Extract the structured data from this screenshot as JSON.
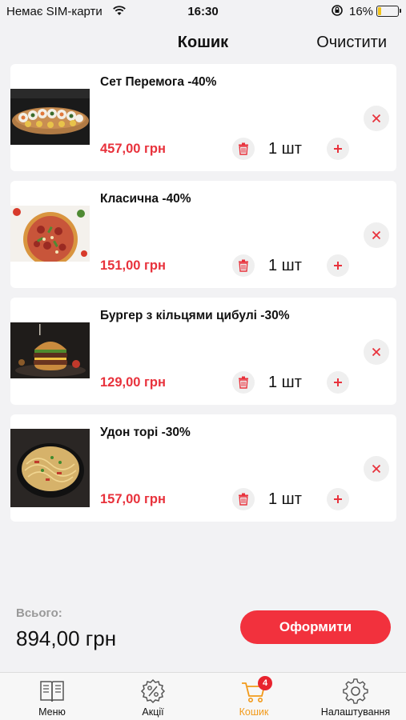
{
  "status_bar": {
    "carrier": "Немає SIM-карти",
    "time": "16:30",
    "battery": "16%",
    "battery_level": 0.16
  },
  "header": {
    "title": "Кошик",
    "clear_label": "Очистити"
  },
  "cart": {
    "items": [
      {
        "name": "Сет Перемога -40%",
        "price": "457,00 грн",
        "qty": "1 шт",
        "image": "sushi-set"
      },
      {
        "name": "Класична -40%",
        "price": "151,00 грн",
        "qty": "1 шт",
        "image": "pizza"
      },
      {
        "name": "Бургер з кільцями цибулі -30%",
        "price": "129,00 грн",
        "qty": "1 шт",
        "image": "burger"
      },
      {
        "name": "Удон торі -30%",
        "price": "157,00 грн",
        "qty": "1 шт",
        "image": "udon"
      }
    ]
  },
  "summary": {
    "total_label": "Всього:",
    "total_value": "894,00 грн",
    "checkout_label": "Оформити"
  },
  "tab_bar": {
    "tabs": [
      {
        "label": "Меню",
        "icon": "menu-book-icon"
      },
      {
        "label": "Акції",
        "icon": "percent-gear-icon"
      },
      {
        "label": "Кошик",
        "icon": "cart-icon",
        "badge": "4",
        "active": true
      },
      {
        "label": "Налаштування",
        "icon": "settings-gear-icon"
      }
    ]
  },
  "colors": {
    "accent_red": "#f2313d",
    "price_red": "#e8323c",
    "active_tab": "#f29a1a",
    "background": "#f2f2f4"
  }
}
